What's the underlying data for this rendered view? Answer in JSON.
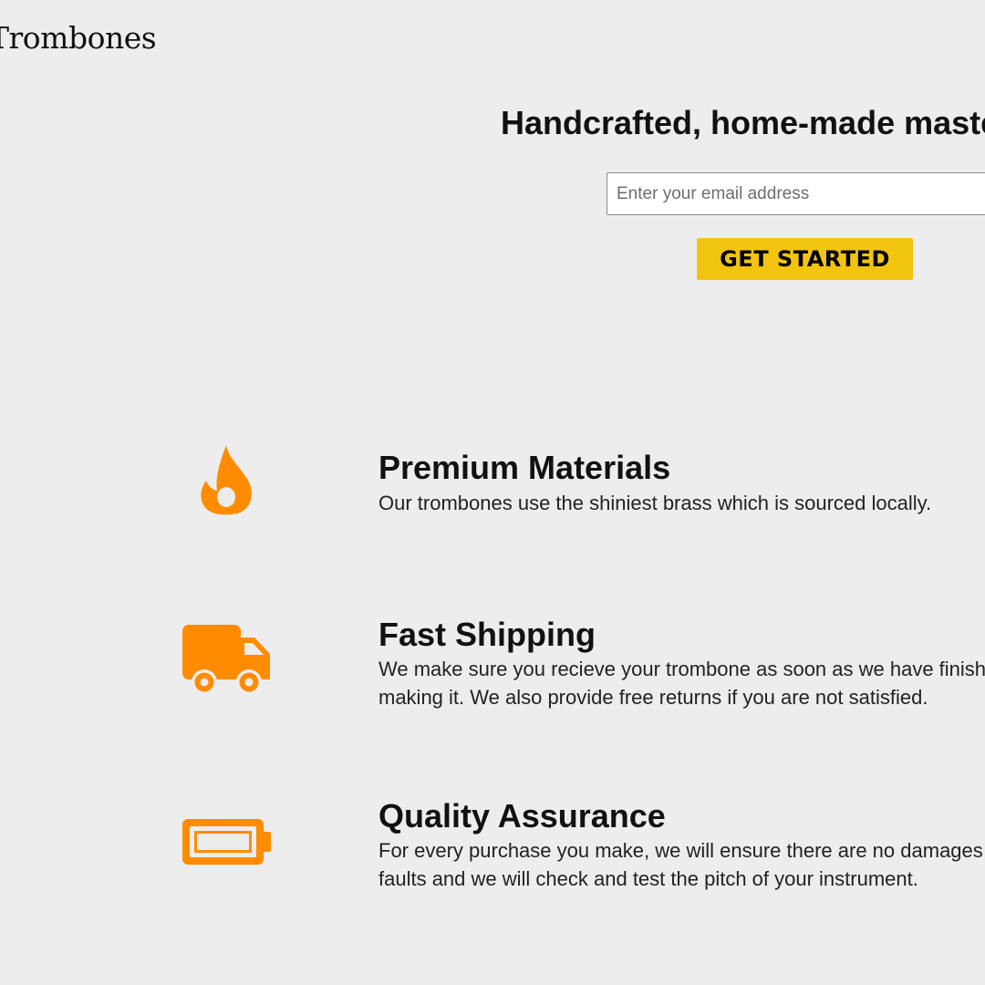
{
  "brand": {
    "logo_text": "Trombones"
  },
  "hero": {
    "title": "Handcrafted, home-made masterpieces",
    "email_placeholder": "Enter your email address",
    "cta_label": "GET STARTED"
  },
  "colors": {
    "background": "#ededed",
    "icon_accent": "#ff8c00",
    "cta_background": "#f1c40f"
  },
  "features": [
    {
      "icon": "fire-icon",
      "title": "Premium Materials",
      "description": "Our trombones use the shiniest brass which is sourced locally."
    },
    {
      "icon": "truck-icon",
      "title": "Fast Shipping",
      "description": "We make sure you recieve your trombone as soon as we have finished making it. We also provide free returns if you are not satisfied."
    },
    {
      "icon": "battery-icon",
      "title": "Quality Assurance",
      "description": "For every purchase you make, we will ensure there are no damages or faults and we will check and test the pitch of your instrument."
    }
  ]
}
